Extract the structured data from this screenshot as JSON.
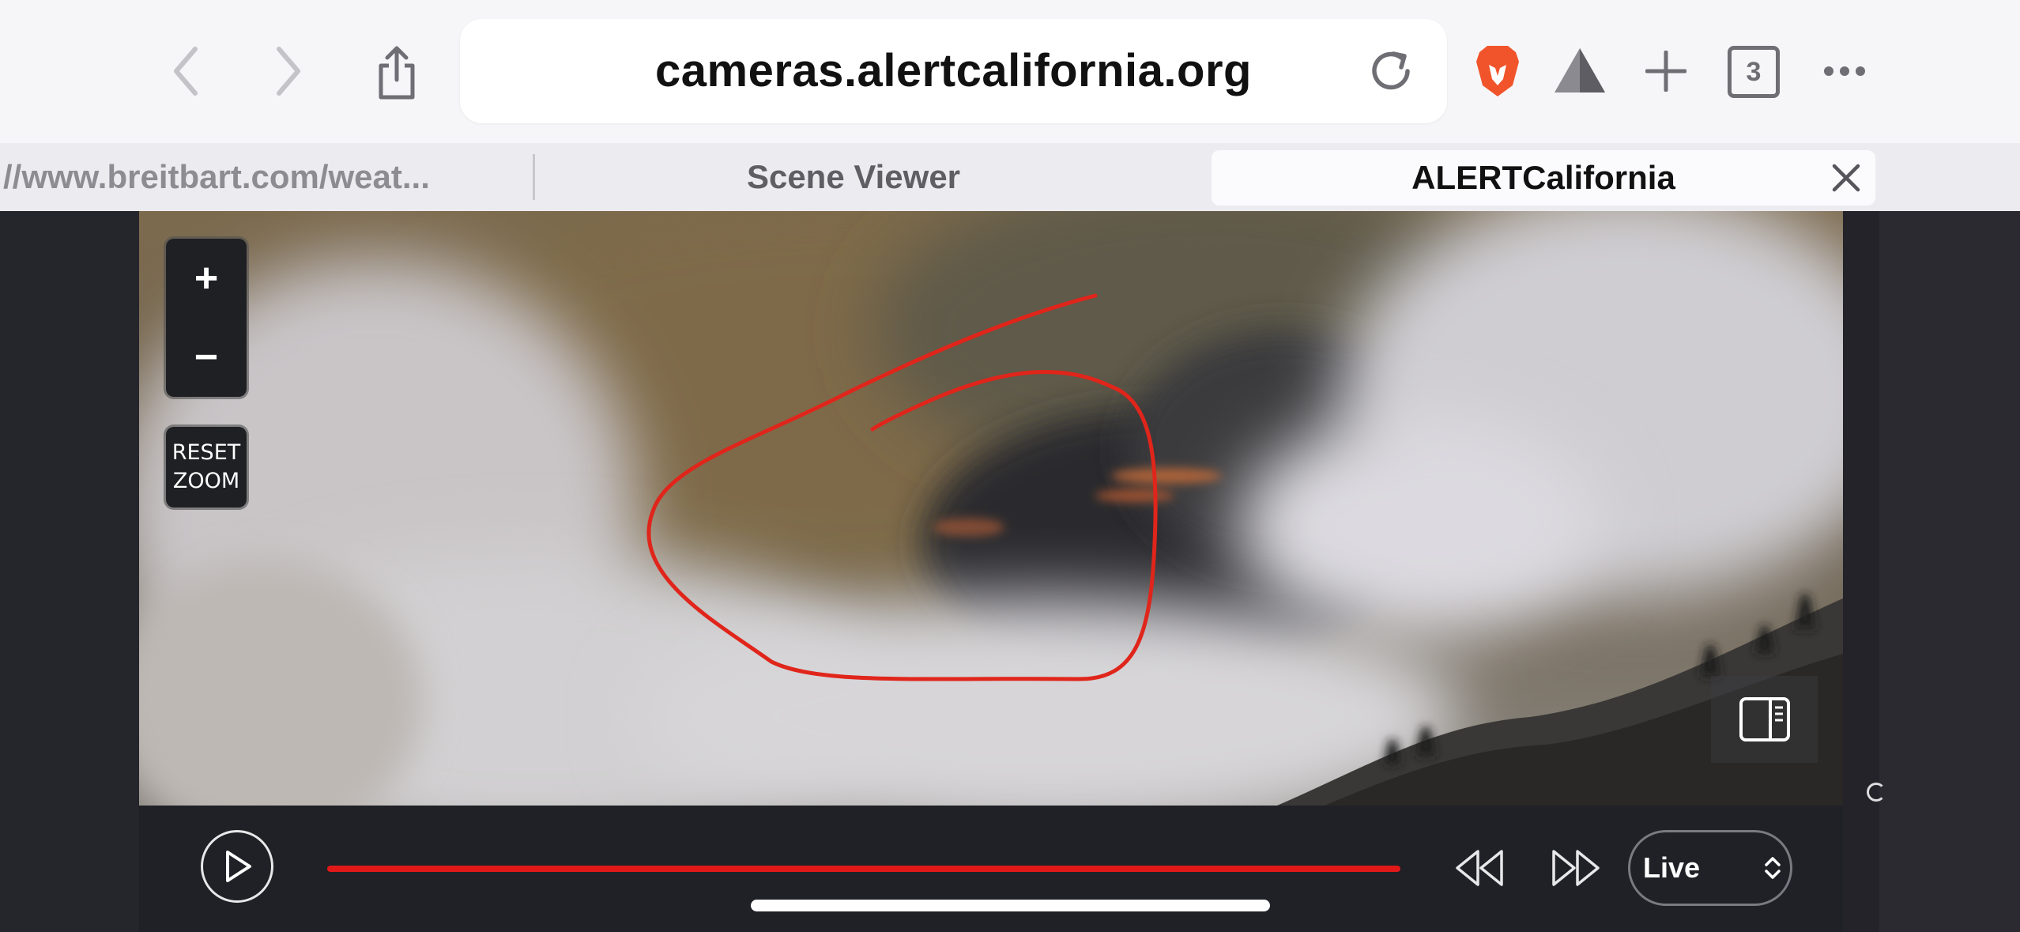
{
  "browser": {
    "url": "cameras.alertcalifornia.org",
    "tab_count": "3",
    "tabs": [
      {
        "label": "//www.breitbart.com/weat..."
      },
      {
        "label": "Scene Viewer"
      },
      {
        "label": "ALERTCalifornia"
      }
    ],
    "icons": [
      "back-icon",
      "forward-icon",
      "share-icon",
      "reload-icon",
      "brave-lion-icon",
      "brave-rewards-icon",
      "new-tab-icon",
      "tab-count-icon",
      "more-icon",
      "close-tab-icon"
    ]
  },
  "viewer": {
    "zoom_in_label": "+",
    "zoom_out_label": "−",
    "reset_line1": "RESET",
    "reset_line2": "ZOOM",
    "annotation_color": "#e0251b"
  },
  "player": {
    "progress_fraction": 1.0,
    "time_mode": "Live",
    "accent_color": "#e01818",
    "icons": [
      "play-icon",
      "skip-back-icon",
      "skip-forward-icon",
      "updown-chevron-icon",
      "sidebar-panel-icon"
    ]
  }
}
